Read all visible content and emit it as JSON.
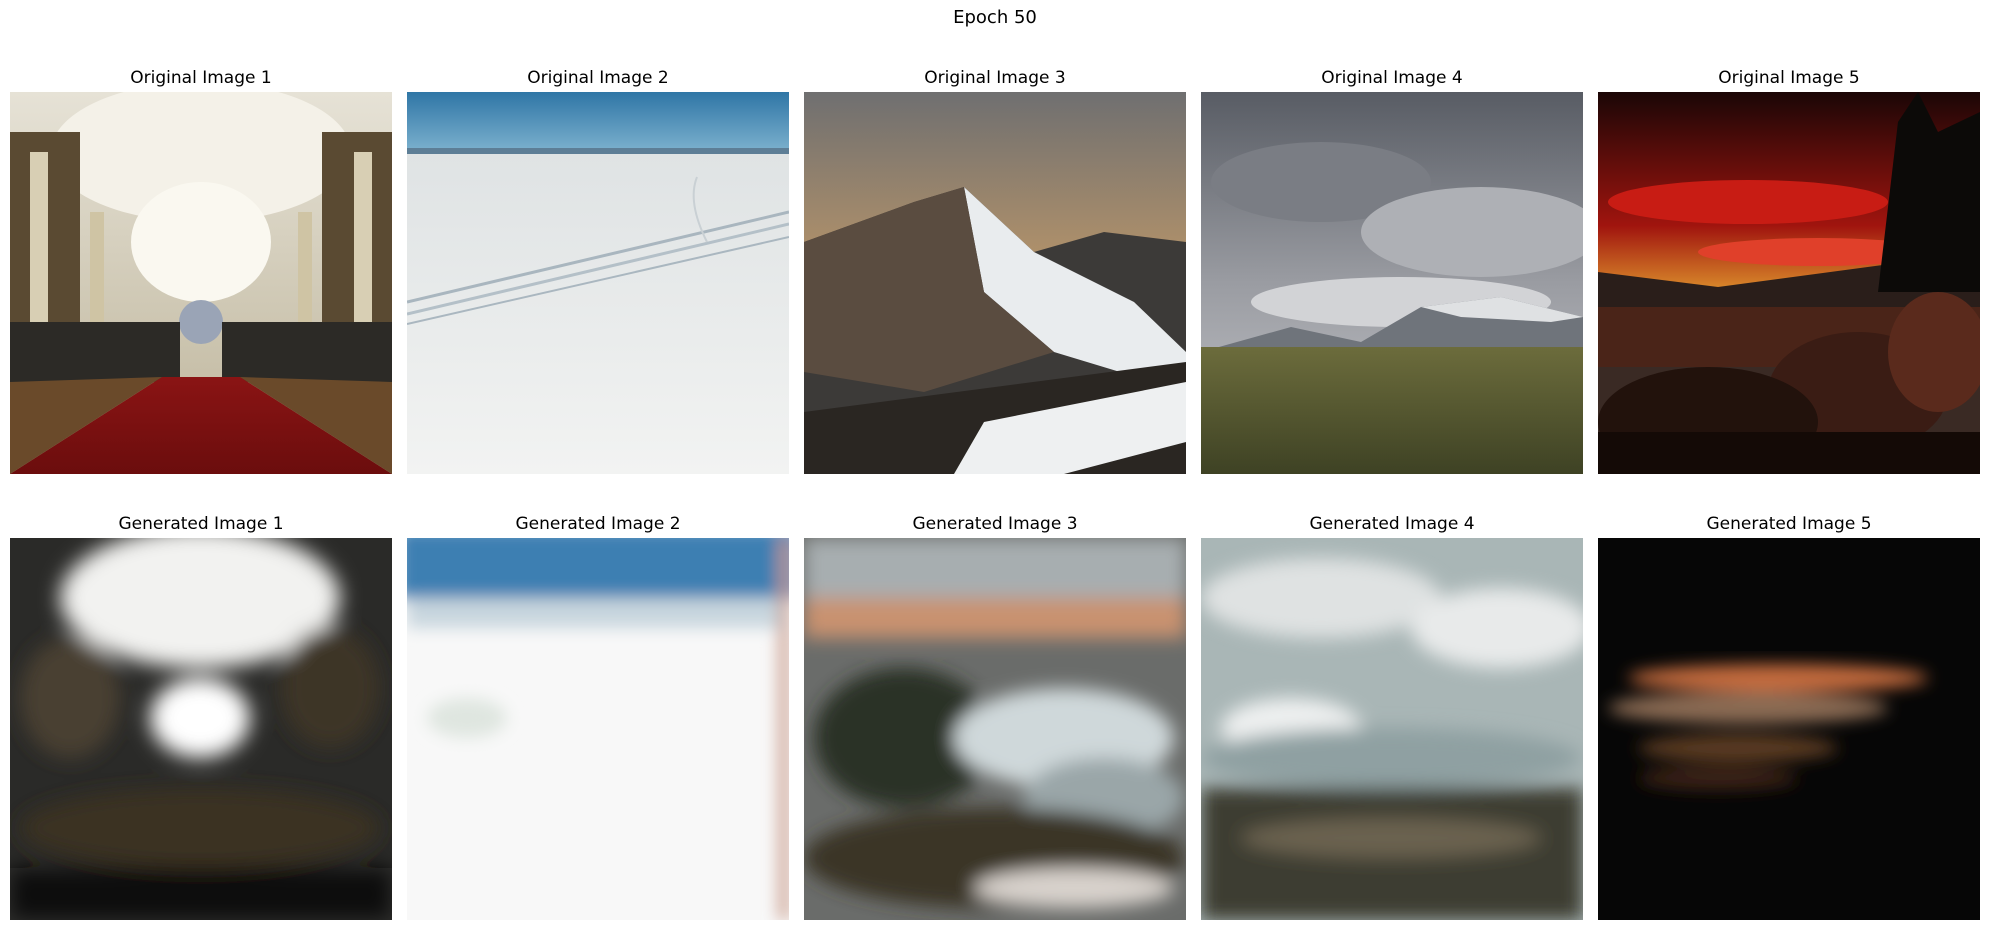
{
  "figure": {
    "title": "Epoch 50"
  },
  "originals": [
    {
      "title": "Original Image 1",
      "scene": "cathedral-interior"
    },
    {
      "title": "Original Image 2",
      "scene": "snow-field"
    },
    {
      "title": "Original Image 3",
      "scene": "snowy-mountain-sunset"
    },
    {
      "title": "Original Image 4",
      "scene": "stormy-sky-grassland"
    },
    {
      "title": "Original Image 5",
      "scene": "red-sunset-lake"
    }
  ],
  "generated": [
    {
      "title": "Generated Image 1",
      "scene": "blurry-cathedral"
    },
    {
      "title": "Generated Image 2",
      "scene": "blurry-snow-field"
    },
    {
      "title": "Generated Image 3",
      "scene": "blurry-mountain"
    },
    {
      "title": "Generated Image 4",
      "scene": "blurry-sky-grassland"
    },
    {
      "title": "Generated Image 5",
      "scene": "blurry-dark-sunset"
    }
  ]
}
